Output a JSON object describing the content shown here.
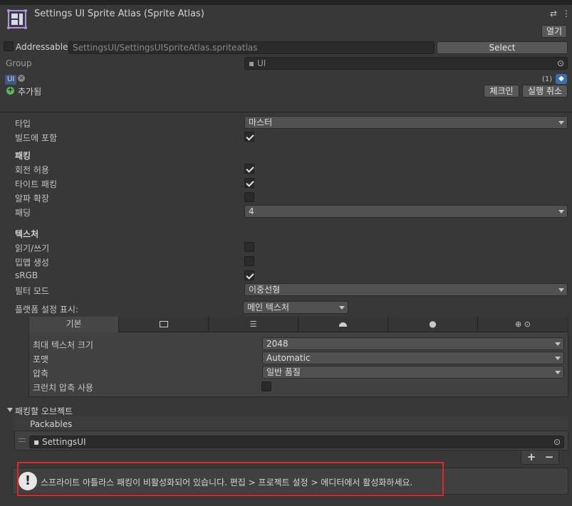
{
  "header": {
    "title": "Settings UI Sprite Atlas (Sprite Atlas)",
    "open_label": "열기"
  },
  "addressable": {
    "label": "Addressable",
    "checked": false,
    "path": "SettingsUI/SettingsUISpriteAtlas.spriteatlas",
    "select_label": "Select"
  },
  "group": {
    "label": "Group",
    "value": "UI"
  },
  "labels": {
    "tag": "UI",
    "added_text": "추가됨",
    "count": "(1)",
    "checkin_label": "체크인",
    "revert_label": "실행 취소"
  },
  "general": {
    "type_label": "타입",
    "type_value": "마스터",
    "include_build_label": "빌드에 포함",
    "include_build": true
  },
  "packing": {
    "header": "패킹",
    "rotation_label": "회전 허용",
    "rotation": true,
    "tight_label": "타이트 패킹",
    "tight": true,
    "alpha_label": "알파 확장",
    "alpha": false,
    "padding_label": "패딩",
    "padding_value": "4"
  },
  "texture": {
    "header": "텍스처",
    "readwrite_label": "읽기/쓰기",
    "readwrite": false,
    "mipmap_label": "밉맵 생성",
    "mipmap": false,
    "srgb_label": "sRGB",
    "srgb": true,
    "filter_label": "필터 모드",
    "filter_value": "이중선형"
  },
  "platform": {
    "label": "플랫폼 설정 표시:",
    "value": "메인 텍스처",
    "tabs": [
      {
        "label": "기본",
        "icon": "default",
        "active": true
      },
      {
        "label": "",
        "icon": "monitor-icon",
        "active": false
      },
      {
        "label": "",
        "icon": "server-icon",
        "active": false
      },
      {
        "label": "",
        "icon": "android-icon",
        "active": false
      },
      {
        "label": "",
        "icon": "apple-icon",
        "active": false
      },
      {
        "label": "",
        "icon": "web-icon",
        "active": false
      }
    ],
    "max_size_label": "최대 텍스처 크기",
    "max_size_value": "2048",
    "format_label": "포맷",
    "format_value": "Automatic",
    "compression_label": "압축",
    "compression_value": "일반 품질",
    "crunch_label": "크런치 압축 사용",
    "crunch": false
  },
  "packables": {
    "section_title": "패킹할 오브젝트",
    "list_header": "Packables",
    "items": [
      "SettingsUI"
    ],
    "add_label": "+",
    "remove_label": "−"
  },
  "warning": {
    "text": "스프라이트 아틀라스 패킹이 비활성화되어 있습니다. 편집 > 프로젝트 설정 > 에디터에서 활성화하세요.",
    "border_color": "#e0262b"
  }
}
